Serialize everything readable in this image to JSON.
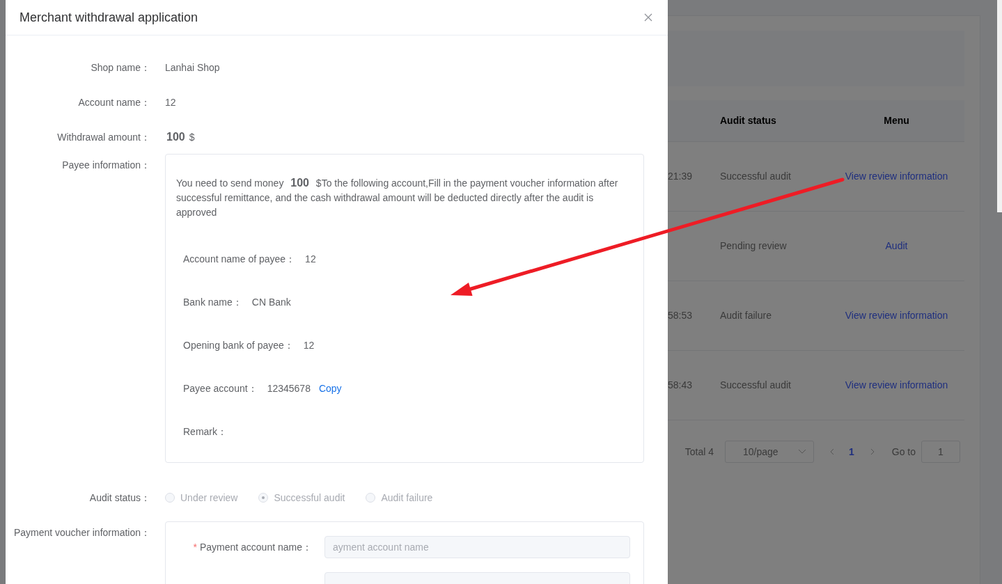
{
  "dialog": {
    "title": "Merchant withdrawal application",
    "fields": [
      {
        "label": "Shop name：",
        "value": "Lanhai Shop"
      },
      {
        "label": "Account name：",
        "value": "12"
      }
    ],
    "withdrawal_amount": {
      "label": "Withdrawal amount：",
      "amount": "100",
      "unit": "$"
    },
    "payee_information": {
      "label": "Payee information：",
      "notice": "You need to send money **100** $To the following account,Fill in the payment voucher information after successful remittance, and the cash withdrawal amount will be deducted directly after the audit is approved",
      "items": [
        {
          "label": "Account name of payee：",
          "value": "12"
        },
        {
          "label": "Bank name：",
          "value": "CN Bank"
        },
        {
          "label": "Opening bank of payee：",
          "value": "12"
        },
        {
          "label": "Payee account：",
          "value": "12345678",
          "action": "Copy"
        },
        {
          "label": "Remark："
        }
      ]
    },
    "audit_status": {
      "label": "Audit status：",
      "disabled": true,
      "options": [
        {
          "label": "Under review",
          "selected": false
        },
        {
          "label": "Successful audit",
          "selected": true
        },
        {
          "label": "Audit failure",
          "selected": false
        }
      ]
    },
    "payment_voucher": {
      "label": "Payment voucher information：",
      "fields": [
        {
          "kind": "text",
          "required_mark": "*",
          "label": "Payment account name：",
          "placeholder": "ayment account name"
        },
        {
          "kind": "text"
        }
      ]
    }
  },
  "table": {
    "columns": [
      {
        "label": "Audit status"
      },
      {
        "label": "Menu"
      }
    ],
    "rows": [
      {
        "column_1": "21:39",
        "status": "Successful audit",
        "action": "View review information"
      },
      {
        "status": "Pending review",
        "action": "Audit"
      },
      {
        "column_1": "58:53",
        "status": "Audit failure",
        "action": "View review information"
      },
      {
        "column_1": "58:43",
        "status": "Successful audit",
        "action": "View review information"
      }
    ]
  },
  "pagination": {
    "total": "Total 4",
    "page_size": "10/page",
    "pages": [
      {
        "label": "1",
        "selected": true
      }
    ],
    "goto_label": "Go to",
    "goto_value": "1"
  }
}
